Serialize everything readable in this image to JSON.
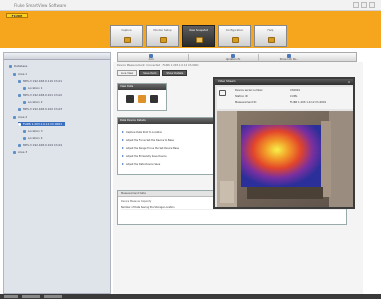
{
  "window": {
    "title": "Fluke SmartView Software"
  },
  "brand": {
    "logo_text": "FLUKE"
  },
  "module_tabs": [
    {
      "label": "Capture"
    },
    {
      "label": "Monitor Setup"
    },
    {
      "label": "View Snapshot"
    },
    {
      "label": "Configuration"
    },
    {
      "label": "Help"
    }
  ],
  "tree": {
    "items": [
      {
        "label": "Database"
      },
      {
        "label": "Area 1"
      },
      {
        "label": "MPS-3 192.168.0.110 Ch.01"
      },
      {
        "label": "Location 1"
      },
      {
        "label": "MPS-3 192.168.0.101 Ch.02"
      },
      {
        "label": "Location 2"
      },
      {
        "label": "MPS-3 192.168.0.102 Ch.03"
      },
      {
        "label": "Area 2"
      },
      {
        "label": "FLIR6 1.203.1.0.12 Ch.0001"
      },
      {
        "label": "Location 3"
      },
      {
        "label": "Location 4"
      },
      {
        "label": "MPS-3 192.168.0.104 Ch.04"
      },
      {
        "label": "Area 3"
      }
    ]
  },
  "toolbar": {
    "items": [
      {
        "label": "Add"
      },
      {
        "label": "Update Info"
      },
      {
        "label": "Show Info Pa..."
      }
    ]
  },
  "info_row": {
    "text": "Device Measurement: Connected  ·  FLIR6 1.203.1.0.12 Ch.0001"
  },
  "sub_tabs": [
    {
      "label": "Live View"
    },
    {
      "label": "Save Item"
    },
    {
      "label": "Show Details"
    }
  ],
  "view_panel": {
    "title": "View Data"
  },
  "actions_panel": {
    "title": "Data Device Details",
    "items": [
      {
        "label": "Capture Data Shot to Location"
      },
      {
        "label": "Adjust the Focus Set the Device to Base"
      },
      {
        "label": "Adjust the Range Focus the Set Device Base"
      },
      {
        "label": "Adjust the Emissivity Save Device"
      },
      {
        "label": "Adjust the Data Device Save"
      }
    ]
  },
  "measurement": {
    "title": "Measurement Data",
    "subtitle": "Device Measure Capacity",
    "rows": [
      {
        "label": "Number of Data Saving the Storage Location",
        "value": "1"
      }
    ]
  },
  "viewer": {
    "title": "Video Stream",
    "close": "×",
    "fields": [
      {
        "label": "Device serial number",
        "value": "Ch0001"
      },
      {
        "label": "Station ID",
        "value": "CUML"
      },
      {
        "label": "Measurement ID",
        "value": "FLIR6 1.203.1.0.12 Ch.0001"
      }
    ]
  },
  "colors": {
    "brand_orange": "#f6a61c",
    "active_tab": "#2b2b2b",
    "selection_blue": "#3a6fbf"
  }
}
